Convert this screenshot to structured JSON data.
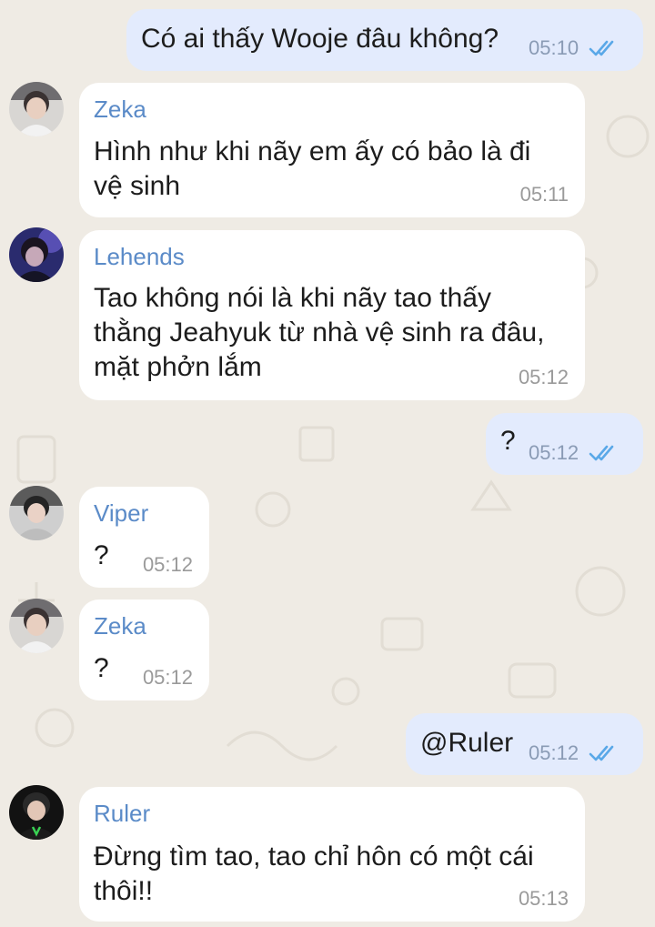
{
  "messages": [
    {
      "dir": "out",
      "text": "Có ai thấy Wooje đâu không?",
      "time": "05:10",
      "read": true
    },
    {
      "dir": "in",
      "sender": "Zeka",
      "text": "Hình như khi nãy em ấy có bảo là đi\nvệ sinh",
      "time": "05:11"
    },
    {
      "dir": "in",
      "sender": "Lehends",
      "text": "Tao không nói là khi nãy tao thấy\nthằng Jeahyuk từ nhà vệ sinh ra đâu,\nmặt phởn lắm",
      "time": "05:12"
    },
    {
      "dir": "out",
      "text": "?",
      "time": "05:12",
      "read": true
    },
    {
      "dir": "in",
      "sender": "Viper",
      "text": "?",
      "time": "05:12"
    },
    {
      "dir": "in",
      "sender": "Zeka",
      "text": "?",
      "time": "05:12"
    },
    {
      "dir": "out",
      "text": "@Ruler",
      "time": "05:12",
      "read": true
    },
    {
      "dir": "in",
      "sender": "Ruler",
      "text": "Đừng tìm tao, tao chỉ hôn có một cái\nthôi!!",
      "time": "05:13"
    }
  ],
  "colors": {
    "background": "#efebe4",
    "outgoing_bubble": "#e3ebfd",
    "incoming_bubble": "#ffffff",
    "sender_name": "#5b8bc8",
    "read_check": "#5aa8e8"
  },
  "icons": {
    "read_receipt": "double-check-icon"
  }
}
